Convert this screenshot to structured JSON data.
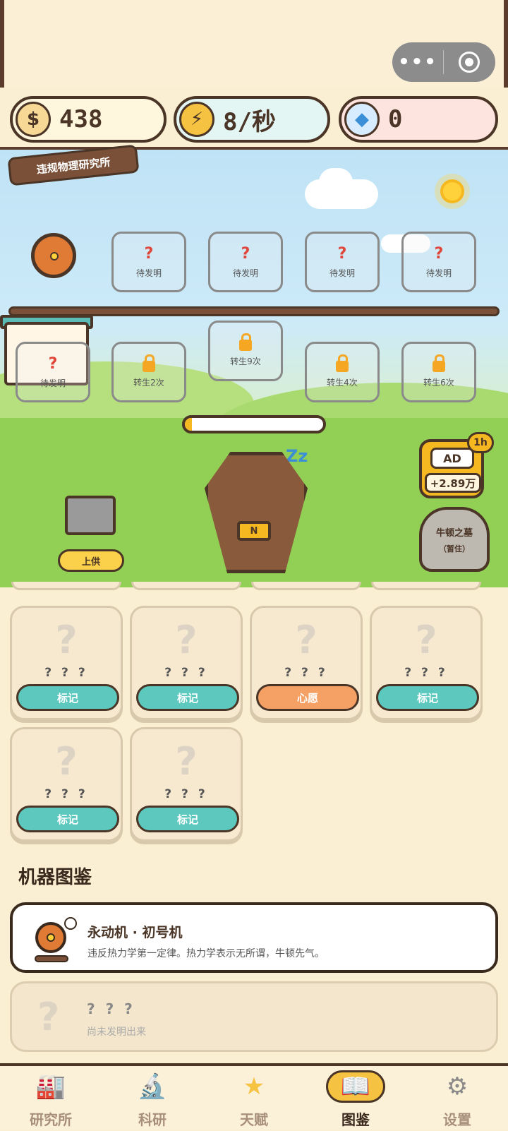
{
  "capsule": {
    "more_glyph": "•••"
  },
  "resources": {
    "coins": {
      "icon": "money-bag-icon",
      "glyph": "$",
      "value": "438"
    },
    "energy": {
      "icon": "lightning-icon",
      "glyph": "⚡",
      "value": "8/秒"
    },
    "gems": {
      "icon": "diamond-icon",
      "glyph": "◆",
      "value": "0"
    }
  },
  "scene": {
    "sign": "违规物理研究所",
    "slots_top": [
      {
        "q": "?",
        "label": "待发明"
      },
      {
        "q": "?",
        "label": "待发明"
      },
      {
        "q": "?",
        "label": "待发明"
      },
      {
        "q": "?",
        "label": "待发明"
      }
    ],
    "slots_bottom": [
      {
        "q": "?",
        "label": "待发明"
      },
      {
        "label": "转生2次"
      },
      {
        "label": "转生9次"
      },
      {
        "label": "转生4次"
      },
      {
        "label": "转生6次"
      }
    ],
    "progress": 0.05,
    "coffin_plate": "N",
    "sleep": "Zz",
    "offer_button": "上供",
    "ad": {
      "badge": "1h",
      "label": "AD",
      "amount": "+2.89万"
    },
    "tomb": {
      "title": "牛顿之墓",
      "status": "（暂住）"
    }
  },
  "cards": [
    {
      "title": "? ? ?",
      "button": "标记",
      "style": "teal"
    },
    {
      "title": "? ? ?",
      "button": "标记",
      "style": "teal"
    },
    {
      "title": "? ? ?",
      "button": "心愿",
      "style": "orange"
    },
    {
      "title": "? ? ?",
      "button": "标记",
      "style": "teal"
    },
    {
      "title": "? ? ?",
      "button": "标记",
      "style": "teal"
    },
    {
      "title": "? ? ?",
      "button": "标记",
      "style": "teal"
    }
  ],
  "catalog": {
    "title": "机器图鉴",
    "entries": [
      {
        "name": "永动机 · 初号机",
        "desc": "违反热力学第一定律。热力学表示无所谓，牛顿先气。",
        "icon": "wheel-machine-icon"
      },
      {
        "name": "? ? ?",
        "desc": "尚未发明出来",
        "icon": "question-icon"
      }
    ]
  },
  "nav": [
    {
      "label": "研究所",
      "icon": "factory-icon",
      "glyph": "🏭"
    },
    {
      "label": "科研",
      "icon": "microscope-icon",
      "glyph": "🔬"
    },
    {
      "label": "天赋",
      "icon": "star-icon",
      "glyph": "★"
    },
    {
      "label": "图鉴",
      "icon": "book-icon",
      "glyph": "📖",
      "active": true
    },
    {
      "label": "设置",
      "icon": "gear-icon",
      "glyph": "⚙"
    }
  ]
}
